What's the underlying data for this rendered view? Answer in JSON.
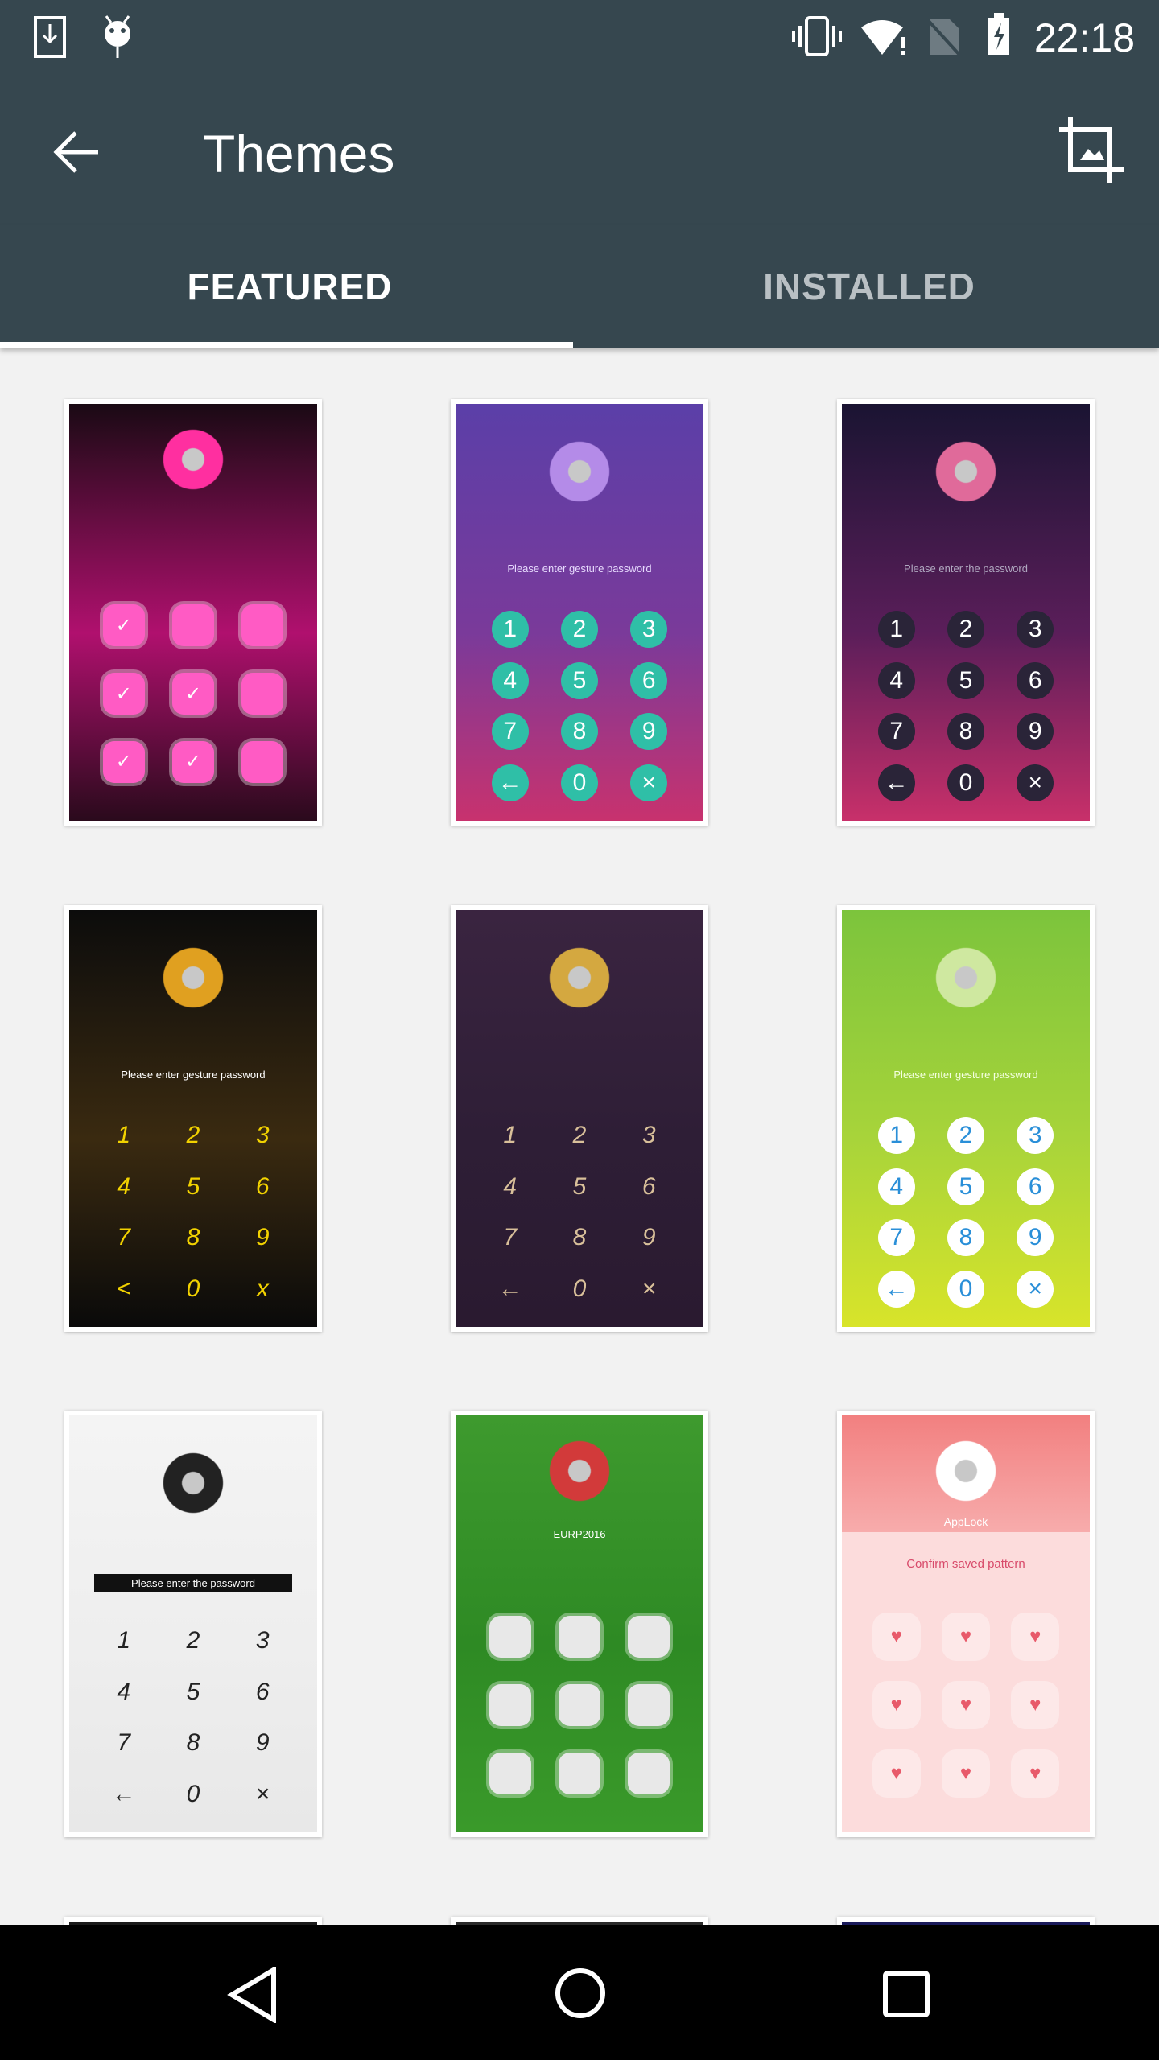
{
  "status_bar": {
    "time": "22:18",
    "left_icons": [
      "download-icon",
      "android-debug-icon"
    ],
    "right_icons": [
      "vibrate-icon",
      "wifi-alert-icon",
      "no-sim-icon",
      "battery-charging-icon"
    ]
  },
  "toolbar": {
    "title": "Themes",
    "back_icon": "arrow-left-icon",
    "action_icon": "crop-icon"
  },
  "tabs": [
    {
      "label": "FEATURED",
      "active": true
    },
    {
      "label": "INSTALLED",
      "active": false
    }
  ],
  "themes": [
    {
      "type": "pattern",
      "bg": [
        "#1a0a14",
        "#b0106e",
        "#2a0a1c"
      ],
      "key_bg": "#ff5bc4",
      "key_color": "#fff",
      "message": "",
      "keys": [
        "✓",
        "",
        "",
        "✓",
        "✓",
        "",
        "✓",
        "✓",
        ""
      ],
      "logo": "#ff2fa0"
    },
    {
      "type": "pin",
      "bg": [
        "#5b3fa8",
        "#7a3a9a",
        "#c8326e"
      ],
      "key_bg": "#2fbfa7",
      "key_color": "#fff",
      "message": "Please enter gesture password",
      "msg_color": "#e8dcff",
      "keys": [
        "1",
        "2",
        "3",
        "4",
        "5",
        "6",
        "7",
        "8",
        "9",
        "←",
        "0",
        "×"
      ],
      "logo": "#b48be8"
    },
    {
      "type": "pin",
      "bg": [
        "#1a1432",
        "#5b1e5a",
        "#c8306a"
      ],
      "key_bg": "#2a2438",
      "key_color": "#fff",
      "message": "Please enter the password",
      "msg_color": "#b0a8c0",
      "keys": [
        "1",
        "2",
        "3",
        "4",
        "5",
        "6",
        "7",
        "8",
        "9",
        "←",
        "0",
        "×"
      ],
      "logo": "#e06a9a"
    },
    {
      "type": "pin",
      "bg": [
        "#0c0c0c",
        "#3a2a10",
        "#0a0a0a"
      ],
      "key_bg": "transparent",
      "key_color": "#f2d200",
      "message": "Please enter gesture password",
      "msg_color": "#fff",
      "keys": [
        "1",
        "2",
        "3",
        "4",
        "5",
        "6",
        "7",
        "8",
        "9",
        "<",
        "0",
        "x"
      ],
      "logo": "#e0a020"
    },
    {
      "type": "pin",
      "bg": [
        "#3a2440",
        "#2e1e36",
        "#2a1a30"
      ],
      "key_bg": "transparent",
      "key_color": "#d9c09a",
      "message": "",
      "keys": [
        "1",
        "2",
        "3",
        "4",
        "5",
        "6",
        "7",
        "8",
        "9",
        "←",
        "0",
        "×"
      ],
      "logo": "#d4a840"
    },
    {
      "type": "pin",
      "bg": [
        "#7cc43c",
        "#a8d43a",
        "#d8e42a"
      ],
      "key_bg": "#ffffff",
      "key_color": "#2a8fd8",
      "message": "Please enter gesture password",
      "msg_color": "#f4ffe0",
      "keys": [
        "1",
        "2",
        "3",
        "4",
        "5",
        "6",
        "7",
        "8",
        "9",
        "←",
        "0",
        "×"
      ],
      "logo": "#cfe8a0"
    },
    {
      "type": "pin",
      "bg": [
        "#f4f4f4",
        "#eeeeee",
        "#e8e8e8"
      ],
      "key_bg": "transparent",
      "key_color": "#222",
      "message": "Please enter the password",
      "msg_color": "#fff",
      "msg_bg": "#111",
      "keys": [
        "1",
        "2",
        "3",
        "4",
        "5",
        "6",
        "7",
        "8",
        "9",
        "←",
        "0",
        "×"
      ],
      "logo": "#222"
    },
    {
      "type": "pattern",
      "bg": [
        "#3e9a2e",
        "#2e8a24",
        "#3a9a2a"
      ],
      "key_bg": "#e8e8e8",
      "key_color": "#555",
      "message": "EURP2016",
      "msg_color": "#fff",
      "keys": [
        "",
        "",
        "",
        "",
        "",
        "",
        "",
        "",
        ""
      ],
      "logo": "#d23a3a"
    },
    {
      "type": "pattern",
      "bg": [
        "#f28080",
        "#fcd6d6",
        "#fcdede"
      ],
      "key_bg": "#fde8e8",
      "key_color": "#e85a6a",
      "message": "Confirm saved pattern",
      "msg_color": "#d84a6a",
      "title": "AppLock",
      "keys": [
        "♥",
        "♥",
        "♥",
        "♥",
        "♥",
        "♥",
        "♥",
        "♥",
        "♥"
      ],
      "logo": "#ffffff"
    }
  ],
  "navbar": {
    "back_icon": "triangle-back-icon",
    "home_icon": "circle-home-icon",
    "recents_icon": "square-recents-icon"
  }
}
